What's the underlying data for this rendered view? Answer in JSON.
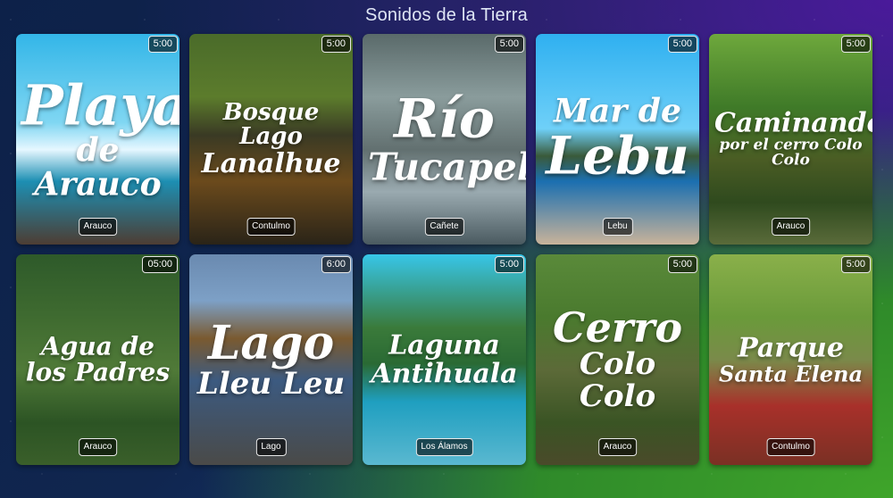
{
  "page": {
    "title": "Sonidos de la Tierra"
  },
  "cards": [
    {
      "lines": [
        "Playa",
        "de Arauco"
      ],
      "duration": "5:00",
      "location": "Arauco",
      "size": [
        62,
        36
      ],
      "bg": "linear-gradient(180deg,#33b6e8 0%,#7fd6f2 42%,#e6f7ff 55%,#1d8fb3 70%,#4d3d33 100%)"
    },
    {
      "lines": [
        "Bosque Lago",
        "Lanalhue"
      ],
      "duration": "5:00",
      "location": "Contulmo",
      "size": [
        26,
        30
      ],
      "bg": "linear-gradient(180deg,#4a6b2a 0%,#5c7c2c 30%,#3a3a24 48%,#6b4a1c 70%,#2a2418 100%)"
    },
    {
      "lines": [
        "Río",
        "Tucapel"
      ],
      "duration": "5:00",
      "location": "Cañete",
      "size": [
        60,
        42
      ],
      "bg": "linear-gradient(180deg,#5a6a6a 0%,#8a9c9c 30%,#627070 55%,#9aaab0 75%,#4a5a60 100%)"
    },
    {
      "lines": [
        "Mar de",
        "Lebu"
      ],
      "duration": "5:00",
      "location": "Lebu",
      "size": [
        36,
        58
      ],
      "bg": "linear-gradient(180deg,#2fb0f0 0%,#6fd0f8 45%,#3a5a3a 58%,#1b6fb0 70%,#c9b39a 100%)"
    },
    {
      "lines": [
        "Caminando",
        "por el cerro Colo Colo"
      ],
      "duration": "5:00",
      "location": "Arauco",
      "size": [
        30,
        17
      ],
      "bg": "linear-gradient(180deg,#6ea83c 0%,#3f7a28 35%,#4a5c24 60%,#2f4a1e 80%,#5a6b3a 100%)"
    },
    {
      "lines": [
        "Agua de",
        "los Padres"
      ],
      "duration": "05:00",
      "location": "Arauco",
      "size": [
        28,
        28
      ],
      "bg": "linear-gradient(180deg,#2e5a2a 0%,#3f6b30 30%,#507a38 55%,#2c5424 80%,#3a5f2a 100%)"
    },
    {
      "lines": [
        "Lago",
        "Lleu Leu"
      ],
      "duration": "6:00",
      "location": "Lago",
      "size": [
        52,
        34
      ],
      "bg": "linear-gradient(180deg,#6a8ab0 0%,#7da0c6 22%,#7a5a30 40%,#3c5a80 60%,#4a4a48 100%)"
    },
    {
      "lines": [
        "Laguna",
        "Antihuala"
      ],
      "duration": "5:00",
      "location": "Los Álamos",
      "size": [
        30,
        30
      ],
      "bg": "linear-gradient(180deg,#37c6e8 0%,#3a7a3a 35%,#2a6a34 52%,#1f9fc0 70%,#5ab8d0 100%)"
    },
    {
      "lines": [
        "Cerro",
        "Colo Colo"
      ],
      "duration": "5:00",
      "location": "Arauco",
      "size": [
        46,
        34
      ],
      "bg": "linear-gradient(180deg,#5a8a3a 0%,#4a7a2e 30%,#5c6a38 55%,#3a5424 80%,#4a4a2a 100%)"
    },
    {
      "lines": [
        "Parque",
        "Santa Elena"
      ],
      "duration": "5:00",
      "location": "Contulmo",
      "size": [
        30,
        24
      ],
      "bg": "linear-gradient(180deg,#8ab04a 0%,#6a9a3a 30%,#7a8a4a 50%,#a8302a 72%,#7a3024 100%)"
    }
  ]
}
